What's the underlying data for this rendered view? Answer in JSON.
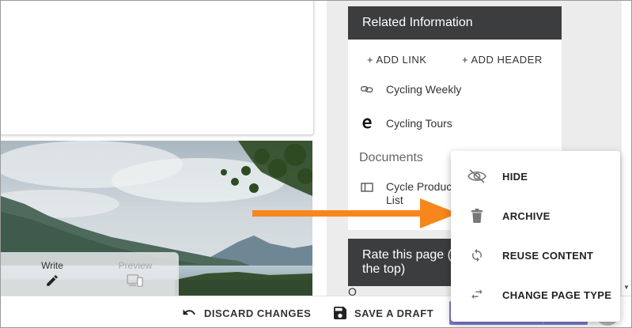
{
  "editor": {
    "write_label": "Write",
    "preview_label": "Preview",
    "icons": {
      "write": "pencil-icon",
      "preview": "devices-icon"
    }
  },
  "related": {
    "title": "Related Information",
    "add_link_label": "+ ADD LINK",
    "add_header_label": "+ ADD HEADER",
    "links": [
      {
        "label": "Cycling Weekly",
        "icon": "link-icon"
      },
      {
        "label": "Cycling Tours",
        "icon": "edge-icon"
      }
    ],
    "documents_title": "Documents",
    "documents": [
      {
        "label": "Cycle Product List",
        "icon": "document-icon"
      }
    ]
  },
  "rate": {
    "title": "Rate this page (",
    "title_line2": "the top)",
    "tail": "O"
  },
  "menu": {
    "items": [
      {
        "label": "HIDE",
        "icon": "eye-off-icon"
      },
      {
        "label": "ARCHIVE",
        "icon": "trash-icon"
      },
      {
        "label": "REUSE CONTENT",
        "icon": "refresh-icon"
      },
      {
        "label": "CHANGE PAGE TYPE",
        "icon": "swap-icon"
      }
    ]
  },
  "bottom_bar": {
    "discard_label": "DISCARD CHANGES",
    "save_draft_label": "SAVE A DRAFT"
  },
  "colors": {
    "panel_header": "#3c3d3f",
    "side_background": "#ececec",
    "primary_button": "#7e7ecf",
    "arrow": "#f7861c"
  }
}
